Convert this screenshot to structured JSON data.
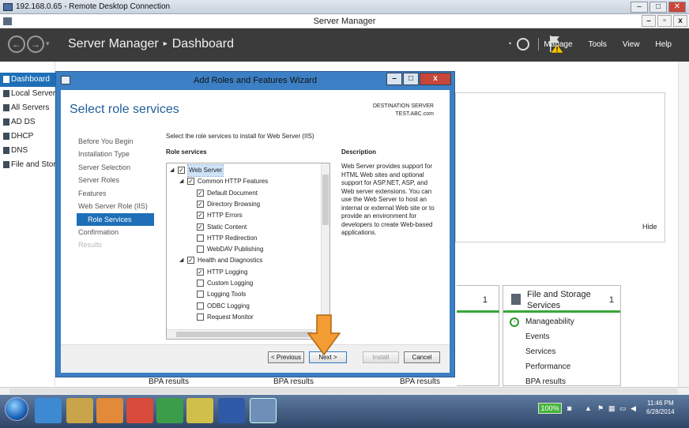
{
  "rdp": {
    "title": "192.168.0.65 - Remote Desktop Connection",
    "ctrls": [
      "–",
      "□",
      "✕"
    ]
  },
  "sm": {
    "window_title": "Server Manager",
    "winctrls": [
      "–",
      "▫",
      "x"
    ],
    "breadcrumb_root": "Server Manager",
    "breadcrumb_sep": "▸",
    "breadcrumb_page": "Dashboard",
    "menu": [
      "Manage",
      "Tools",
      "View",
      "Help"
    ],
    "nav": [
      "Dashboard",
      "Local Server",
      "All Servers",
      "AD DS",
      "DHCP",
      "DNS",
      "File and Storage Services"
    ]
  },
  "dashboard": {
    "hide_label": "Hide",
    "mid_count": "1",
    "fs_tile": {
      "title": "File and Storage Services",
      "count": "1",
      "items": [
        "Manageability",
        "Events",
        "Services",
        "Performance",
        "BPA results"
      ]
    },
    "bpa_labels": [
      "BPA results",
      "BPA results",
      "BPA results"
    ]
  },
  "wizard": {
    "title": "Add Roles and Features Wizard",
    "ctrls": [
      "–",
      "□",
      "x"
    ],
    "heading": "Select role services",
    "dest_label": "DESTINATION SERVER",
    "dest_server": "TEST.ABC.com",
    "steps": [
      "Before You Begin",
      "Installation Type",
      "Server Selection",
      "Server Roles",
      "Features",
      "Web Server Role (IIS)",
      "Role Services",
      "Confirmation",
      "Results"
    ],
    "instructions": "Select the role services to install for Web Server (IIS)",
    "role_services_header": "Role services",
    "description_header": "Description",
    "tree": [
      {
        "label": "Web Server",
        "level": 0,
        "checked": true,
        "expander": "◢",
        "selected": true
      },
      {
        "label": "Common HTTP Features",
        "level": 1,
        "checked": true,
        "expander": "◢"
      },
      {
        "label": "Default Document",
        "level": 2,
        "checked": true
      },
      {
        "label": "Directory Browsing",
        "level": 2,
        "checked": true
      },
      {
        "label": "HTTP Errors",
        "level": 2,
        "checked": true
      },
      {
        "label": "Static Content",
        "level": 2,
        "checked": true
      },
      {
        "label": "HTTP Redirection",
        "level": 2,
        "checked": false
      },
      {
        "label": "WebDAV Publishing",
        "level": 2,
        "checked": false
      },
      {
        "label": "Health and Diagnostics",
        "level": 1,
        "checked": true,
        "expander": "◢"
      },
      {
        "label": "HTTP Logging",
        "level": 2,
        "checked": true
      },
      {
        "label": "Custom Logging",
        "level": 2,
        "checked": false
      },
      {
        "label": "Logging Tools",
        "level": 2,
        "checked": false
      },
      {
        "label": "ODBC Logging",
        "level": 2,
        "checked": false
      },
      {
        "label": "Request Monitor",
        "level": 2,
        "checked": false
      }
    ],
    "description": "Web Server provides support for HTML Web sites and optional support for ASP.NET, ASP, and Web server extensions. You can use the Web Server to host an internal or external Web site or to provide an environment for developers to create Web-based applications.",
    "buttons": {
      "previous": "< Previous",
      "next": "Next >",
      "install": "Install",
      "cancel": "Cancel"
    }
  },
  "taskbar": {
    "battery": "100%",
    "time": "11:46 PM",
    "date": "6/28/2014"
  },
  "colors": {
    "accent": "#1e6fb8",
    "header_bg": "#3b3b3b",
    "wizard_frame": "#3c7fc4",
    "arrow": "#f39c33",
    "status_green": "#3aa53a"
  }
}
